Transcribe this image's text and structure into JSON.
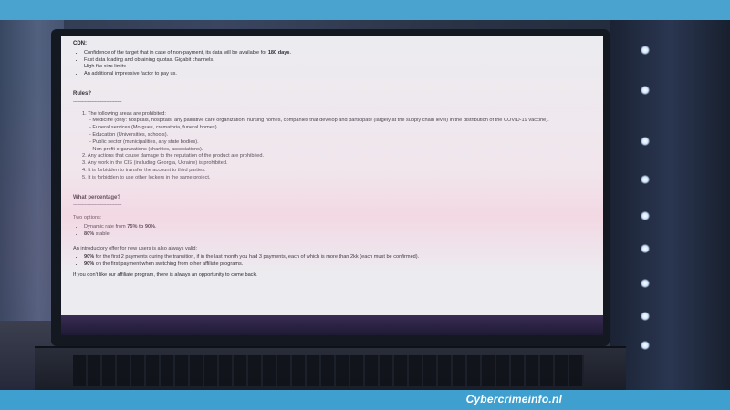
{
  "brand": "Cybercrimeinfo.nl",
  "colors": {
    "band": "#4aa3cf",
    "screen_bg": "#ececf0",
    "text": "#2a2a33"
  },
  "cdn": {
    "heading": "CDN:",
    "items": [
      {
        "pre": "Confidence of the target that in case of non-payment, its data will be available for ",
        "bold": "180 days",
        "post": "."
      },
      {
        "pre": "Fast data loading and obtaining quotas. Gigabit channels.",
        "bold": "",
        "post": ""
      },
      {
        "pre": "High file size limits.",
        "bold": "",
        "post": ""
      },
      {
        "pre": "An additional impressive factor to pay us.",
        "bold": "",
        "post": ""
      }
    ]
  },
  "rules": {
    "heading": "Rules?",
    "rule_line": "----------------------------------",
    "item1": "1. The following areas are prohibited:",
    "sub_items": [
      "- Medicine (only: hospitals, hospitals, any palliative care organization, nursing homes, companies that develop and participate (largely at the supply chain level) in the distribution of the COVID-19 vaccine).",
      "- Funeral services (Morgues, crematoria, funeral homes).",
      "- Education (Universities, schools).",
      "- Public sector (municipalities, any state bodies).",
      "- Non-profit organizations (charities, associations)."
    ],
    "items_rest": [
      "2. Any actions that cause damage to the reputation of the product are prohibited.",
      "3. Any work in the CIS (including Georgia, Ukraine) is prohibited.",
      "4. It is forbidden to transfer the account to third parties.",
      "5. It is forbidden to use other lockers in the same project."
    ]
  },
  "percentage": {
    "heading": "What percentage?",
    "rule_line": "----------------------------------",
    "intro": "Two options:",
    "options": [
      {
        "pre": "Dynamic rate from ",
        "bold": "75% to 90%",
        "post": "."
      },
      {
        "pre": "",
        "bold": "80%",
        "post": " stable."
      }
    ],
    "offer_intro": "An introductory offer for new users is also always valid:",
    "offers": [
      {
        "bold": "90%",
        "post": " for the first 2 payments during the transition, if in the last month you had 3 payments, each of which is more than 2kk (each must be confirmed)."
      },
      {
        "bold": "90%",
        "post": " on the first payment when switching from other affiliate programs."
      }
    ],
    "closing": "If you don't like our affiliate program, there is always an opportunity to come back."
  }
}
